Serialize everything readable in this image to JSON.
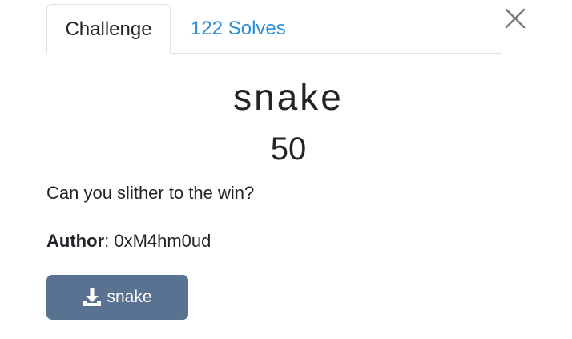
{
  "tabs": [
    {
      "label": "Challenge",
      "active": true
    },
    {
      "label": "122 Solves",
      "active": false
    }
  ],
  "challenge": {
    "name": "snake",
    "points": "50",
    "description": "Can you slither to the win?",
    "author_label": "Author",
    "author_separator": ": ",
    "author": "0xM4hm0ud"
  },
  "download": {
    "icon": "download-icon",
    "label": "snake"
  },
  "close_icon": "close-icon",
  "colors": {
    "accent_link": "#2d8fd8",
    "button_bg": "#5a7291",
    "text": "#212529",
    "border": "#dee2e6"
  }
}
